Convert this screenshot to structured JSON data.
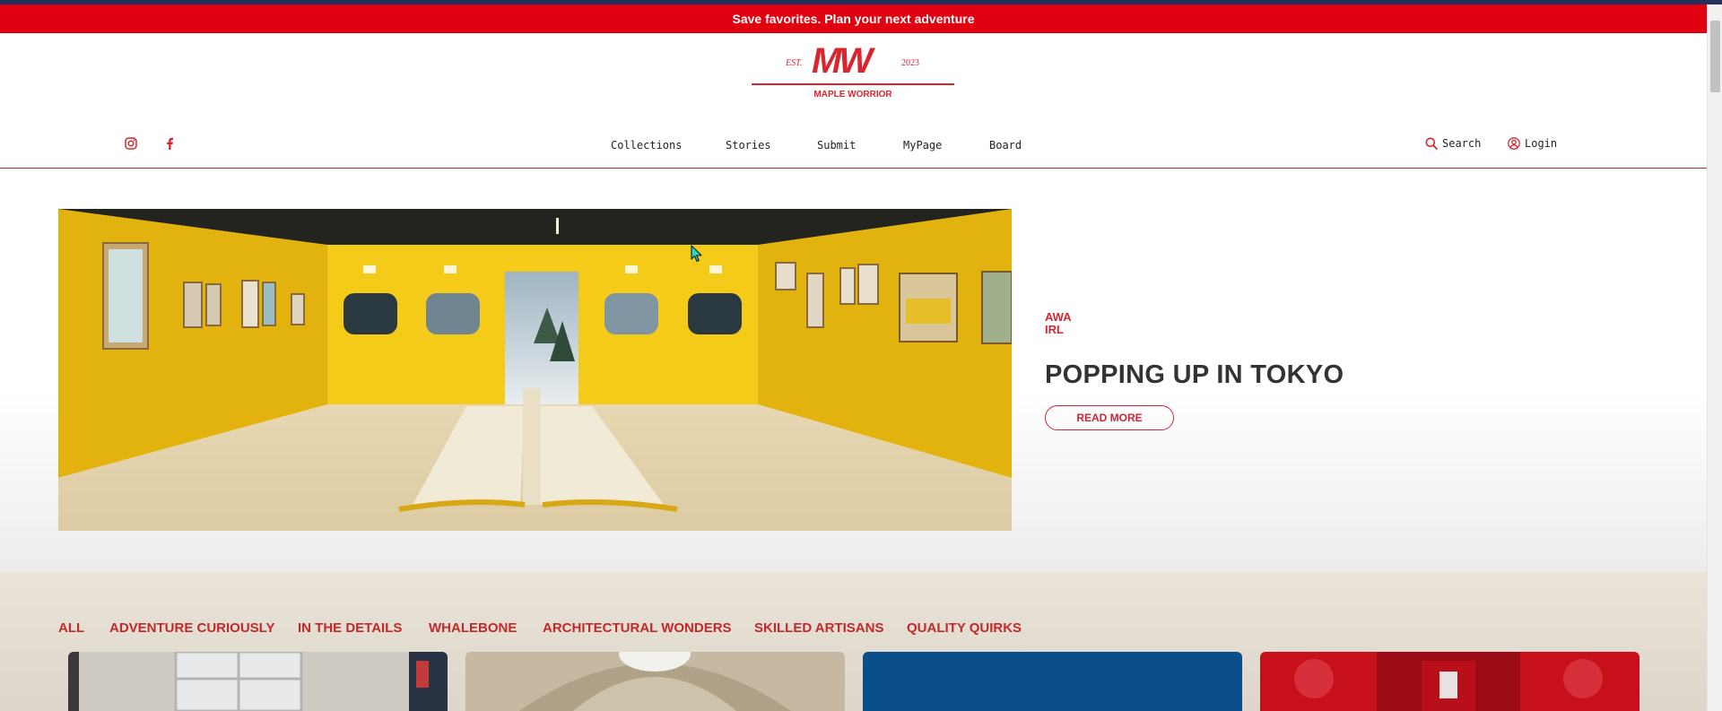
{
  "promo": {
    "text": "Save favorites. Plan your next adventure"
  },
  "logo": {
    "est": "EST.",
    "mark": "MW",
    "year": "2023",
    "name": "MAPLE WORRIOR"
  },
  "social": [
    {
      "icon": "instagram-icon"
    },
    {
      "icon": "facebook-icon"
    }
  ],
  "nav": {
    "items": [
      {
        "label": "Collections"
      },
      {
        "label": "Stories"
      },
      {
        "label": "Submit"
      },
      {
        "label": "MyPage"
      },
      {
        "label": "Board"
      }
    ],
    "search_label": "Search",
    "search_icon": "search-icon",
    "login_label": "Login",
    "login_icon": "user-icon"
  },
  "hero": {
    "category_line1": "AWA",
    "category_line2": "IRL",
    "title": "POPPING UP IN TOKYO",
    "cta": "READ MORE"
  },
  "filters": [
    {
      "label": "ALL"
    },
    {
      "label": "ADVENTURE CURIOUSLY"
    },
    {
      "label": "IN THE DETAILS"
    },
    {
      "label": "WHALEBONE"
    },
    {
      "label": "ARCHITECTURAL WONDERS"
    },
    {
      "label": "SKILLED ARTISANS"
    },
    {
      "label": "QUALITY QUIRKS"
    }
  ],
  "colors": {
    "brand_red": "#e1000f",
    "accent_red": "#d8262e",
    "cta_border": "#c9283a",
    "card_blue": "#0b4f8a",
    "card_red": "#c8101c"
  }
}
